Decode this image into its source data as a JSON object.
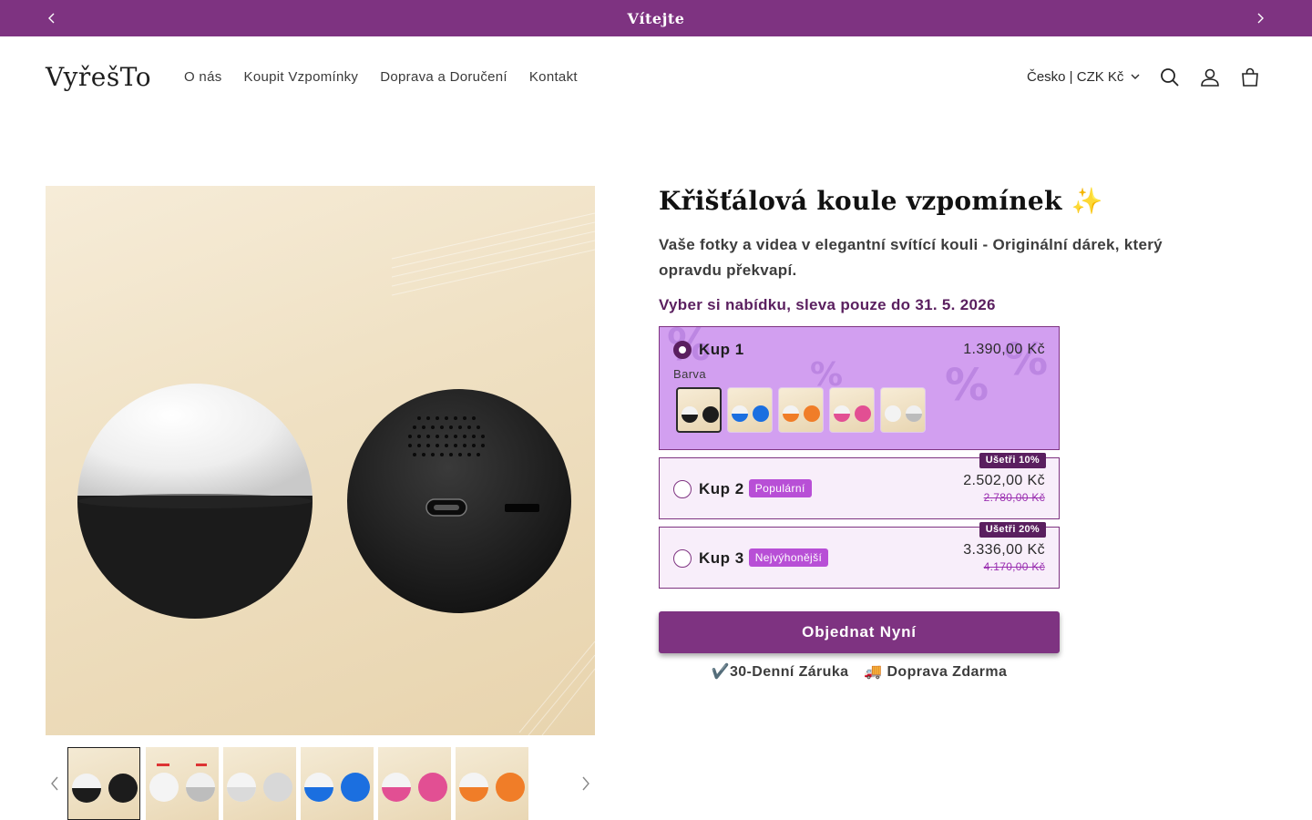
{
  "announcement": {
    "text": "Vítejte"
  },
  "header": {
    "logo": "VyřešTo",
    "nav": [
      "O nás",
      "Koupit Vzpomínky",
      "Doprava a Doručení",
      "Kontakt"
    ],
    "country": "Česko | CZK Kč",
    "icons": [
      "search-icon",
      "account-icon",
      "cart-icon"
    ]
  },
  "gallery": {
    "thumbnails": [
      "black",
      "white-silver",
      "silver",
      "blue",
      "pink",
      "orange"
    ],
    "active_index": 0
  },
  "product": {
    "title": "Křišťálová koule vzpomínek ✨",
    "description": "Vaše fotky a videa v elegantní svítící kouli - Originální dárek, který opravdu překvapí.",
    "offer": "Vyber si nabídku, sleva pouze do 31. 5. 2026",
    "bundles": [
      {
        "label": "Kup 1",
        "price": "1.390,00 Kč",
        "selected": true,
        "color_label": "Barva",
        "colors": [
          "black",
          "blue",
          "orange",
          "pink",
          "silver"
        ]
      },
      {
        "label": "Kup 2",
        "badge": "Populární",
        "price": "2.502,00 Kč",
        "old_price": "2.780,00 Kč",
        "save": "Ušetři 10%"
      },
      {
        "label": "Kup 3",
        "badge": "Nejvýhonější",
        "price": "3.336,00 Kč",
        "old_price": "4.170,00 Kč",
        "save": "Ušetři 20%"
      }
    ],
    "cta": "Objednat Nyní",
    "guarantees": [
      "✔️30-Denní Záruka",
      "🚚 Doprava Zdarma"
    ]
  },
  "colors": {
    "brand": "#7e3381",
    "brand_dark": "#5a1f5f",
    "selected_bg": "#d29ff0",
    "badge": "#b84fd6"
  }
}
